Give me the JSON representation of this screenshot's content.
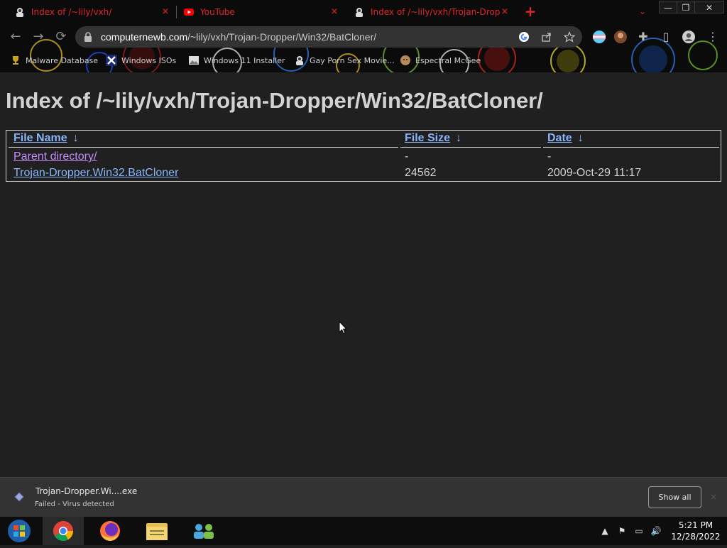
{
  "browser": {
    "tabs": [
      {
        "title": "Index of /~lily/vxh/",
        "close": "×"
      },
      {
        "title": "YouTube",
        "close": "×"
      },
      {
        "title": "Index of /~lily/vxh/Trojan-Dropp",
        "close": "×"
      }
    ],
    "new_tab": "+",
    "tab_search": "⌄",
    "window_controls": {
      "minimize": "—",
      "maximize": "❐",
      "close": "✕"
    },
    "nav": {
      "back": "←",
      "forward": "→",
      "reload": "⟳"
    },
    "address": {
      "host": "computernewb.com",
      "path": "/~lily/vxh/Trojan-Dropper/Win32/BatCloner/"
    },
    "toolbar_icons": [
      "google-lens-icon",
      "share-icon",
      "star-icon",
      "extension-icon",
      "side-panel-icon",
      "profile-icon",
      "menu-icon"
    ],
    "bookmarks": [
      {
        "label": "Malware Database",
        "icon": "trophy-icon"
      },
      {
        "label": "Windows ISOs",
        "icon": "x-logo-icon"
      },
      {
        "label": "Windows 11 Installer",
        "icon": "image-icon"
      },
      {
        "label": "Gay Porn Sex Movie...",
        "icon": "hoodie-icon"
      },
      {
        "label": "Espectral McGee",
        "icon": "face-icon"
      }
    ]
  },
  "page": {
    "title": "Index of /~lily/vxh/Trojan-Dropper/Win32/BatCloner/",
    "columns": [
      {
        "label": "File Name",
        "sort_arrow": "↓"
      },
      {
        "label": "File Size",
        "sort_arrow": "↓"
      },
      {
        "label": "Date",
        "sort_arrow": "↓"
      }
    ],
    "rows": [
      {
        "name": "Parent directory/",
        "size": "-",
        "date": "-"
      },
      {
        "name": "Trojan-Dropper.Win32.BatCloner",
        "size": "24562",
        "date": "2009-Oct-29 11:17"
      }
    ]
  },
  "download": {
    "filename": "Trojan-Dropper.Wi....exe",
    "status": "Failed - Virus detected",
    "show_all": "Show all",
    "close": "×"
  },
  "taskbar": {
    "apps": [
      "start-orb-icon",
      "chrome-icon",
      "firefox-icon",
      "file-explorer-icon",
      "network-people-icon"
    ],
    "tray": {
      "chevron": "▲",
      "flag": "⚑",
      "network": "▭",
      "volume": "🔊"
    },
    "time": "5:21 PM",
    "date": "12/28/2022"
  },
  "colors": {
    "tab_text": "#e0272c",
    "link": "#8ab4f8",
    "visited_link": "#c58af9",
    "page_bg": "#202020",
    "text": "#d2d2d2"
  }
}
